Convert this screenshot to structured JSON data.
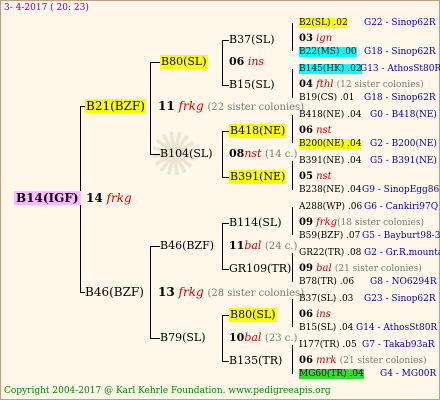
{
  "header_date": "3- 4-2017 ( 20: 23)",
  "footer": "Copyright 2004-2017 @ Karl Kehrle Foundation.  www.pedigreeapis.org",
  "root": {
    "id": "B14(IGF)",
    "year": "14",
    "line": "frkg"
  },
  "gen1": [
    {
      "id": "B21(BZF)",
      "year": "11",
      "line": "frkg",
      "note": "(22 sister colonies)"
    },
    {
      "id": "B46(BZF)",
      "year": "13",
      "line": "frkg",
      "note": "(28 sister colonies)"
    }
  ],
  "gen2": [
    {
      "id": "B80(SL)",
      "year": "06",
      "line": "ins"
    },
    {
      "id": "B104(SL)",
      "year": "08",
      "line": "nst",
      "note": "(14 c.)"
    },
    {
      "id": "B114(SL)",
      "year": "11",
      "line": "bal",
      "note": "(24 c.)"
    },
    {
      "id": "B80(SL)",
      "year": "10",
      "line": "bal",
      "note": "(23 c.)"
    }
  ],
  "gen3": [
    {
      "id": "B37(SL)",
      "year": "03",
      "line": "ign"
    },
    {
      "id": "B15(SL)",
      "year": "04",
      "line": "fthl",
      "note": "(12 sister colonies)"
    },
    {
      "id": "B418(NE)",
      "year": "06",
      "line": "nst"
    },
    {
      "id": "B391(NE)",
      "year": "05",
      "line": "nst"
    },
    {
      "id": "A288(WP)",
      "year": "09",
      "line": "frkg",
      "note": "(18 sister colonies)"
    },
    {
      "id": "GR22(TR)",
      "year": "09",
      "line": "bal",
      "note": "(21 sister colonies)"
    },
    {
      "id": "B37(SL)",
      "year": "06",
      "line": "ins"
    },
    {
      "id": "I177(TR)",
      "year": "06",
      "line": "mrk",
      "note": "(21 sister colonies)"
    }
  ],
  "dam_labels": {
    "b104": "B104(SL)",
    "b46": "B46(BZF)",
    "b79": "B79(SL)",
    "gr109": "GR109(TR)",
    "b135": "B135(TR)"
  },
  "gen4": [
    {
      "left": "B2(SL) .02",
      "right": "G22 - Sinop62R"
    },
    {
      "left": "B22(MS) .00",
      "right": "G18 - Sinop62R"
    },
    {
      "left": "B145(HK) .02",
      "right": "G13 - AthosSt80R"
    },
    {
      "left": "B19(CS) .01",
      "right": "G18 - Sinop62R"
    },
    {
      "left": "B418(NE) .04",
      "right": "G0 - B418(NE)"
    },
    {
      "left": "B200(NE) .04",
      "right": "G2 - B200(NE)"
    },
    {
      "left": "B391(NE) .04",
      "right": "G5 - B391(NE)"
    },
    {
      "left": "B238(NE) .04",
      "right": "G9 - SinopEgg86R"
    },
    {
      "left": "A288(WP) .06",
      "right": "G6 - Cankiri97Q"
    },
    {
      "left": "B59(BZF) .07",
      "right": "G5 - Bayburt98-3"
    },
    {
      "left": "GR22(TR) .08",
      "right": "G2 - Gr.R.mounta"
    },
    {
      "left": "B78(TR) .06",
      "right": "G8 - NO6294R"
    },
    {
      "left": "B37(SL) .03",
      "right": "G23 - Sinop62R"
    },
    {
      "left": "B15(SL) .04",
      "right": "G14 - AthosSt80R"
    },
    {
      "left": "I177(TR) .05",
      "right": "G7 - Takab93aR"
    },
    {
      "left": "MG60(TR) .04",
      "right": "G4 - MG00R"
    }
  ],
  "colors": {
    "highlight_yellow": "#ffff00",
    "highlight_cyan": "#00ffff",
    "highlight_green": "#33dd33",
    "root_highlight": "#ffbbff",
    "line_red": "#cc0000",
    "text_blue": "#0000bb",
    "date_purple": "#8a00a0"
  }
}
